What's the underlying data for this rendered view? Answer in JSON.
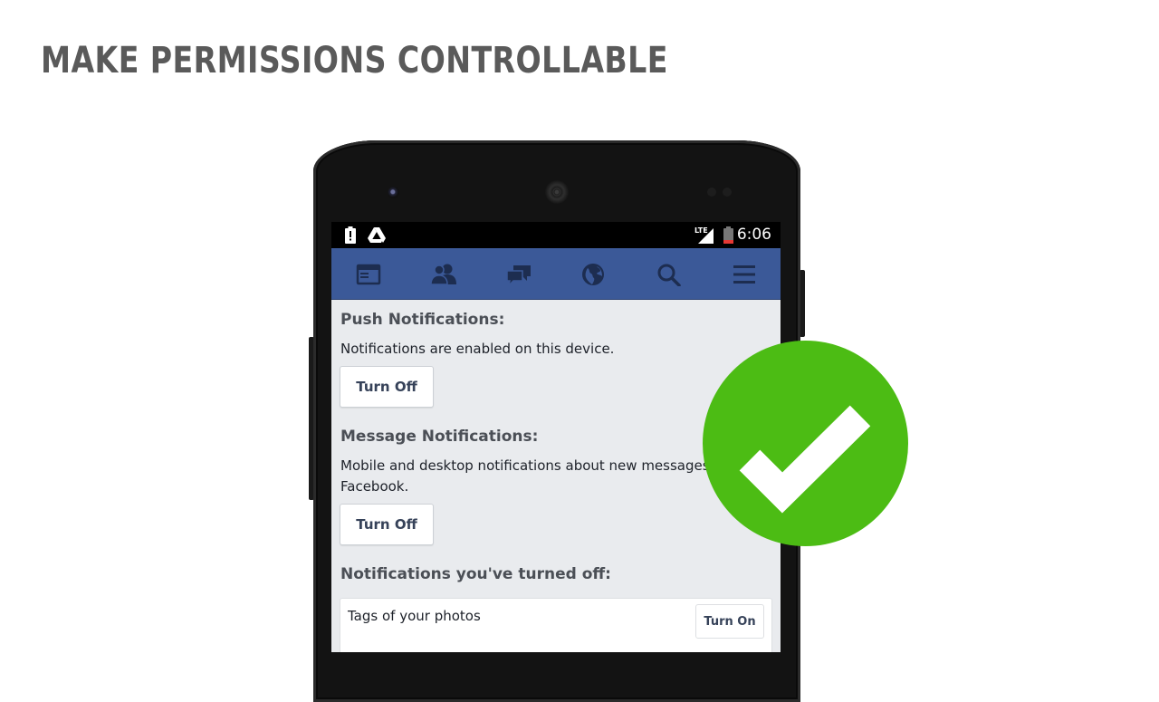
{
  "slide": {
    "title": "MAKE PERMISSIONS CONTROLLABLE"
  },
  "status_bar": {
    "time": "6:06",
    "network_label": "LTE",
    "left_icons": [
      "alert-battery-icon",
      "drive-icon"
    ],
    "right_icons": [
      "signal-icon",
      "battery-low-icon"
    ]
  },
  "nav": {
    "color": "#3b5998",
    "icons": [
      "news-feed-icon",
      "friends-icon",
      "messages-icon",
      "globe-icon",
      "search-icon",
      "menu-icon"
    ]
  },
  "push": {
    "title": "Push Notifications:",
    "description": "Notifications are enabled on this device.",
    "button": "Turn Off"
  },
  "message": {
    "title": "Message Notifications:",
    "description": "Mobile and desktop notifications about new messages",
    "description_line2": "Facebook.",
    "button": "Turn Off"
  },
  "turned_off": {
    "title": "Notifications you've turned off:",
    "items": [
      {
        "label": "Tags of your photos",
        "button": "Turn On"
      }
    ]
  },
  "badge": {
    "icon": "check-badge-icon",
    "color": "#4cbc14"
  }
}
